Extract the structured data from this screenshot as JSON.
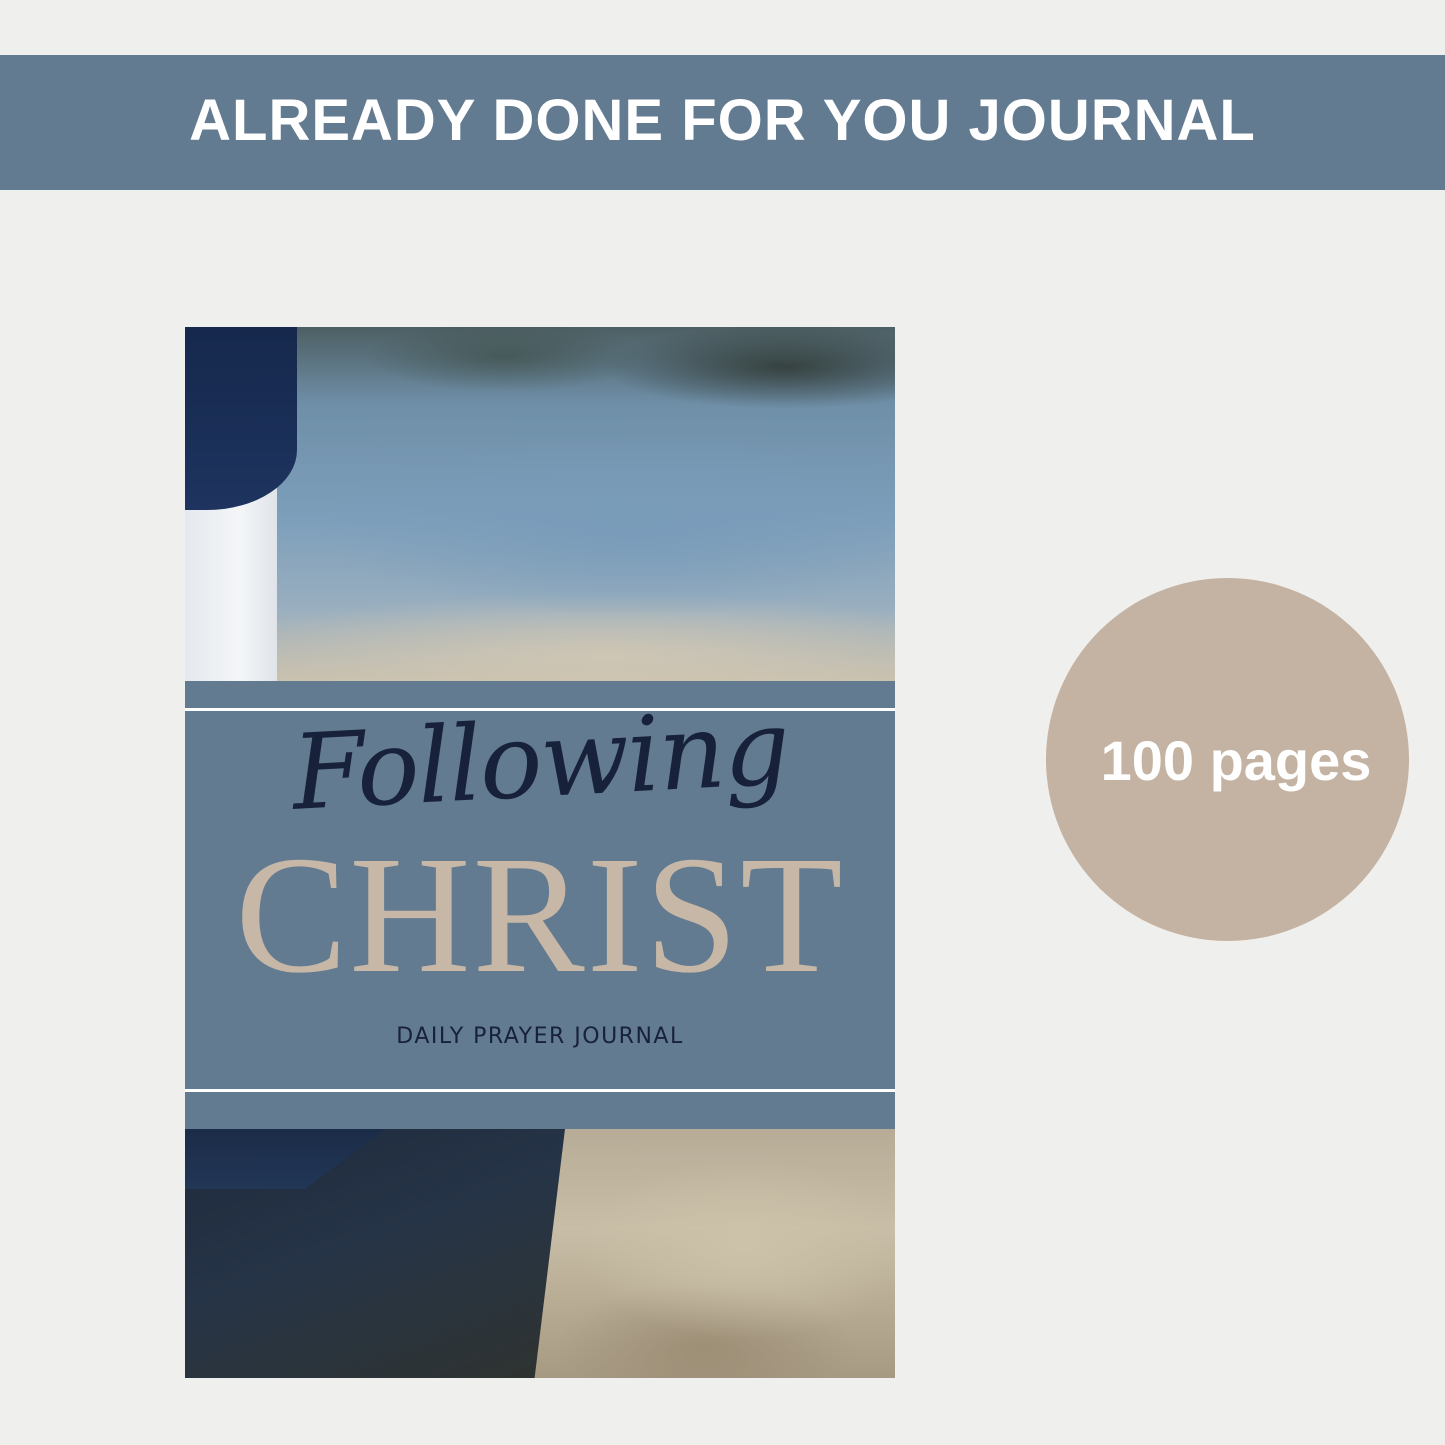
{
  "banner": {
    "title": "ALREADY DONE FOR YOU JOURNAL"
  },
  "journal_cover": {
    "script_title": "Following",
    "main_title": "CHRIST",
    "subtitle": "DAILY PRAYER JOURNAL"
  },
  "badge": {
    "label": "100 pages"
  },
  "colors": {
    "background": "#efefed",
    "banner": "#627b91",
    "cover_band": "#627b91",
    "title_beige": "#c7b7a6",
    "script_navy": "#17213a",
    "badge": "#c4b3a2"
  }
}
